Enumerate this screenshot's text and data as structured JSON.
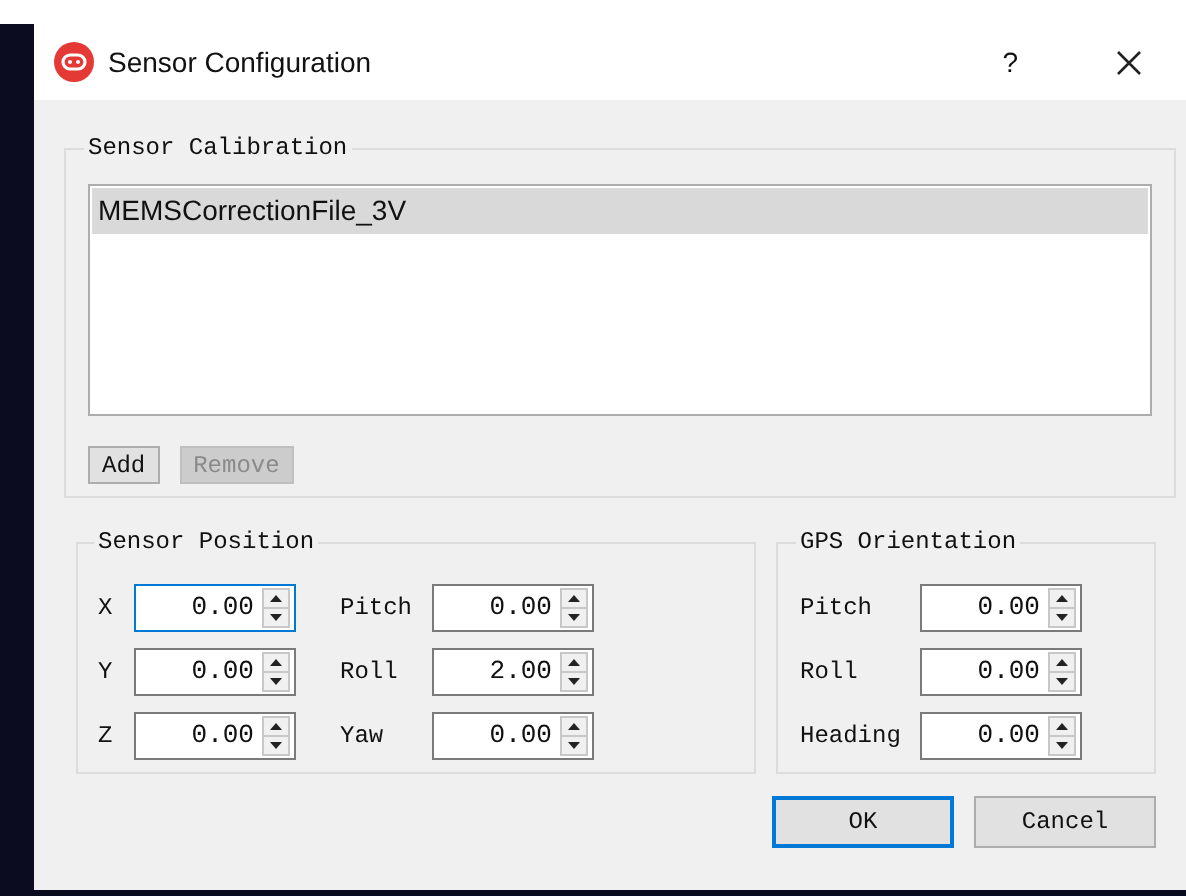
{
  "window": {
    "title": "Sensor Configuration",
    "help": "?"
  },
  "sensor_calibration": {
    "title": "Sensor Calibration",
    "files": [
      {
        "name": "MEMSCorrectionFile_3V",
        "selected": true
      }
    ],
    "buttons": [
      {
        "label": "Add",
        "disabled": false
      },
      {
        "label": "Remove",
        "disabled": true
      }
    ]
  },
  "sensor_position": {
    "title": "Sensor Position",
    "columns": [
      [
        {
          "label": "X",
          "value": "0.00",
          "focused": true
        },
        {
          "label": "Y",
          "value": "0.00",
          "focused": false
        },
        {
          "label": "Z",
          "value": "0.00",
          "focused": false
        }
      ],
      [
        {
          "label": "Pitch",
          "value": "0.00",
          "focused": false
        },
        {
          "label": "Roll",
          "value": "2.00",
          "focused": false
        },
        {
          "label": "Yaw",
          "value": "0.00",
          "focused": false
        }
      ]
    ]
  },
  "gps_orientation": {
    "title": "GPS Orientation",
    "fields": [
      {
        "label": "Pitch",
        "value": "0.00",
        "focused": false
      },
      {
        "label": "Roll",
        "value": "0.00",
        "focused": false
      },
      {
        "label": "Heading",
        "value": "0.00",
        "focused": false
      }
    ]
  },
  "buttons": [
    {
      "label": "OK",
      "default": true
    },
    {
      "label": "Cancel",
      "default": false
    }
  ]
}
